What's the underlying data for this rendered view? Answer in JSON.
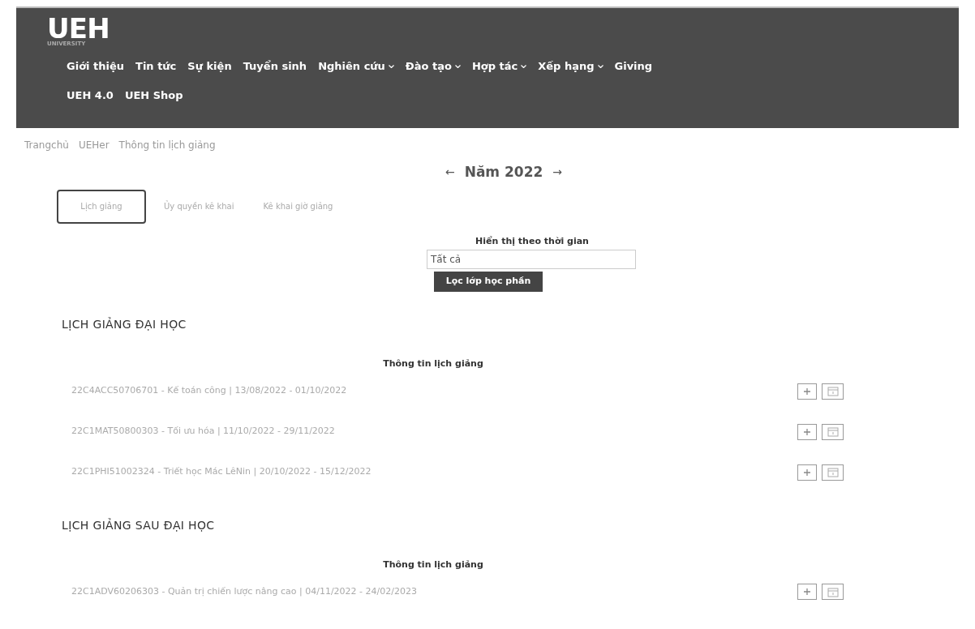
{
  "header": {
    "logo": "UEH",
    "logo_subtitle": "UNIVERSITY",
    "nav": [
      {
        "label": "Giới thiệu",
        "dropdown": false
      },
      {
        "label": "Tin tức",
        "dropdown": false
      },
      {
        "label": "Sự kiện",
        "dropdown": false
      },
      {
        "label": "Tuyển sinh",
        "dropdown": false
      },
      {
        "label": "Nghiên cứu",
        "dropdown": true
      },
      {
        "label": "Đào tạo",
        "dropdown": true
      },
      {
        "label": "Hợp tác",
        "dropdown": true
      },
      {
        "label": "Xếp hạng",
        "dropdown": true
      },
      {
        "label": "Giving",
        "dropdown": false
      },
      {
        "label": "UEH 4.0",
        "dropdown": false
      },
      {
        "label": "UEH Shop",
        "dropdown": false
      }
    ]
  },
  "breadcrumb": [
    "Trangchủ",
    "UEHer",
    "Thông tin lịch giảng"
  ],
  "year": {
    "prev": "←",
    "label": "Năm 2022",
    "next": "→"
  },
  "tabs": [
    {
      "label": "Lịch giảng",
      "selected": true
    },
    {
      "label": "Ủy quyền kê khai",
      "selected": false
    },
    {
      "label": "Kê khai giờ giảng",
      "selected": false
    }
  ],
  "filter": {
    "label": "Hiển thị theo thời gian",
    "value": "Tất cả",
    "button": "Lọc lớp học phần"
  },
  "sections": [
    {
      "heading": "LỊCH GIẢNG ĐẠI HỌC",
      "card_title": "Thông tin lịch giảng",
      "rows": [
        "22C4ACC50706701 - Kế toán công | 13/08/2022 - 01/10/2022",
        "22C1MAT50800303 - Tối ưu hóa | 11/10/2022 - 29/11/2022",
        "22C1PHI51002324 - Triết học Mác LêNin | 20/10/2022 - 15/12/2022"
      ]
    },
    {
      "heading": "LỊCH GIẢNG SAU ĐẠI HỌC",
      "card_title": "Thông tin lịch giảng",
      "rows": [
        "22C1ADV60206303 - Quản trị chiến lược nâng cao | 04/11/2022 - 24/02/2023"
      ]
    }
  ]
}
